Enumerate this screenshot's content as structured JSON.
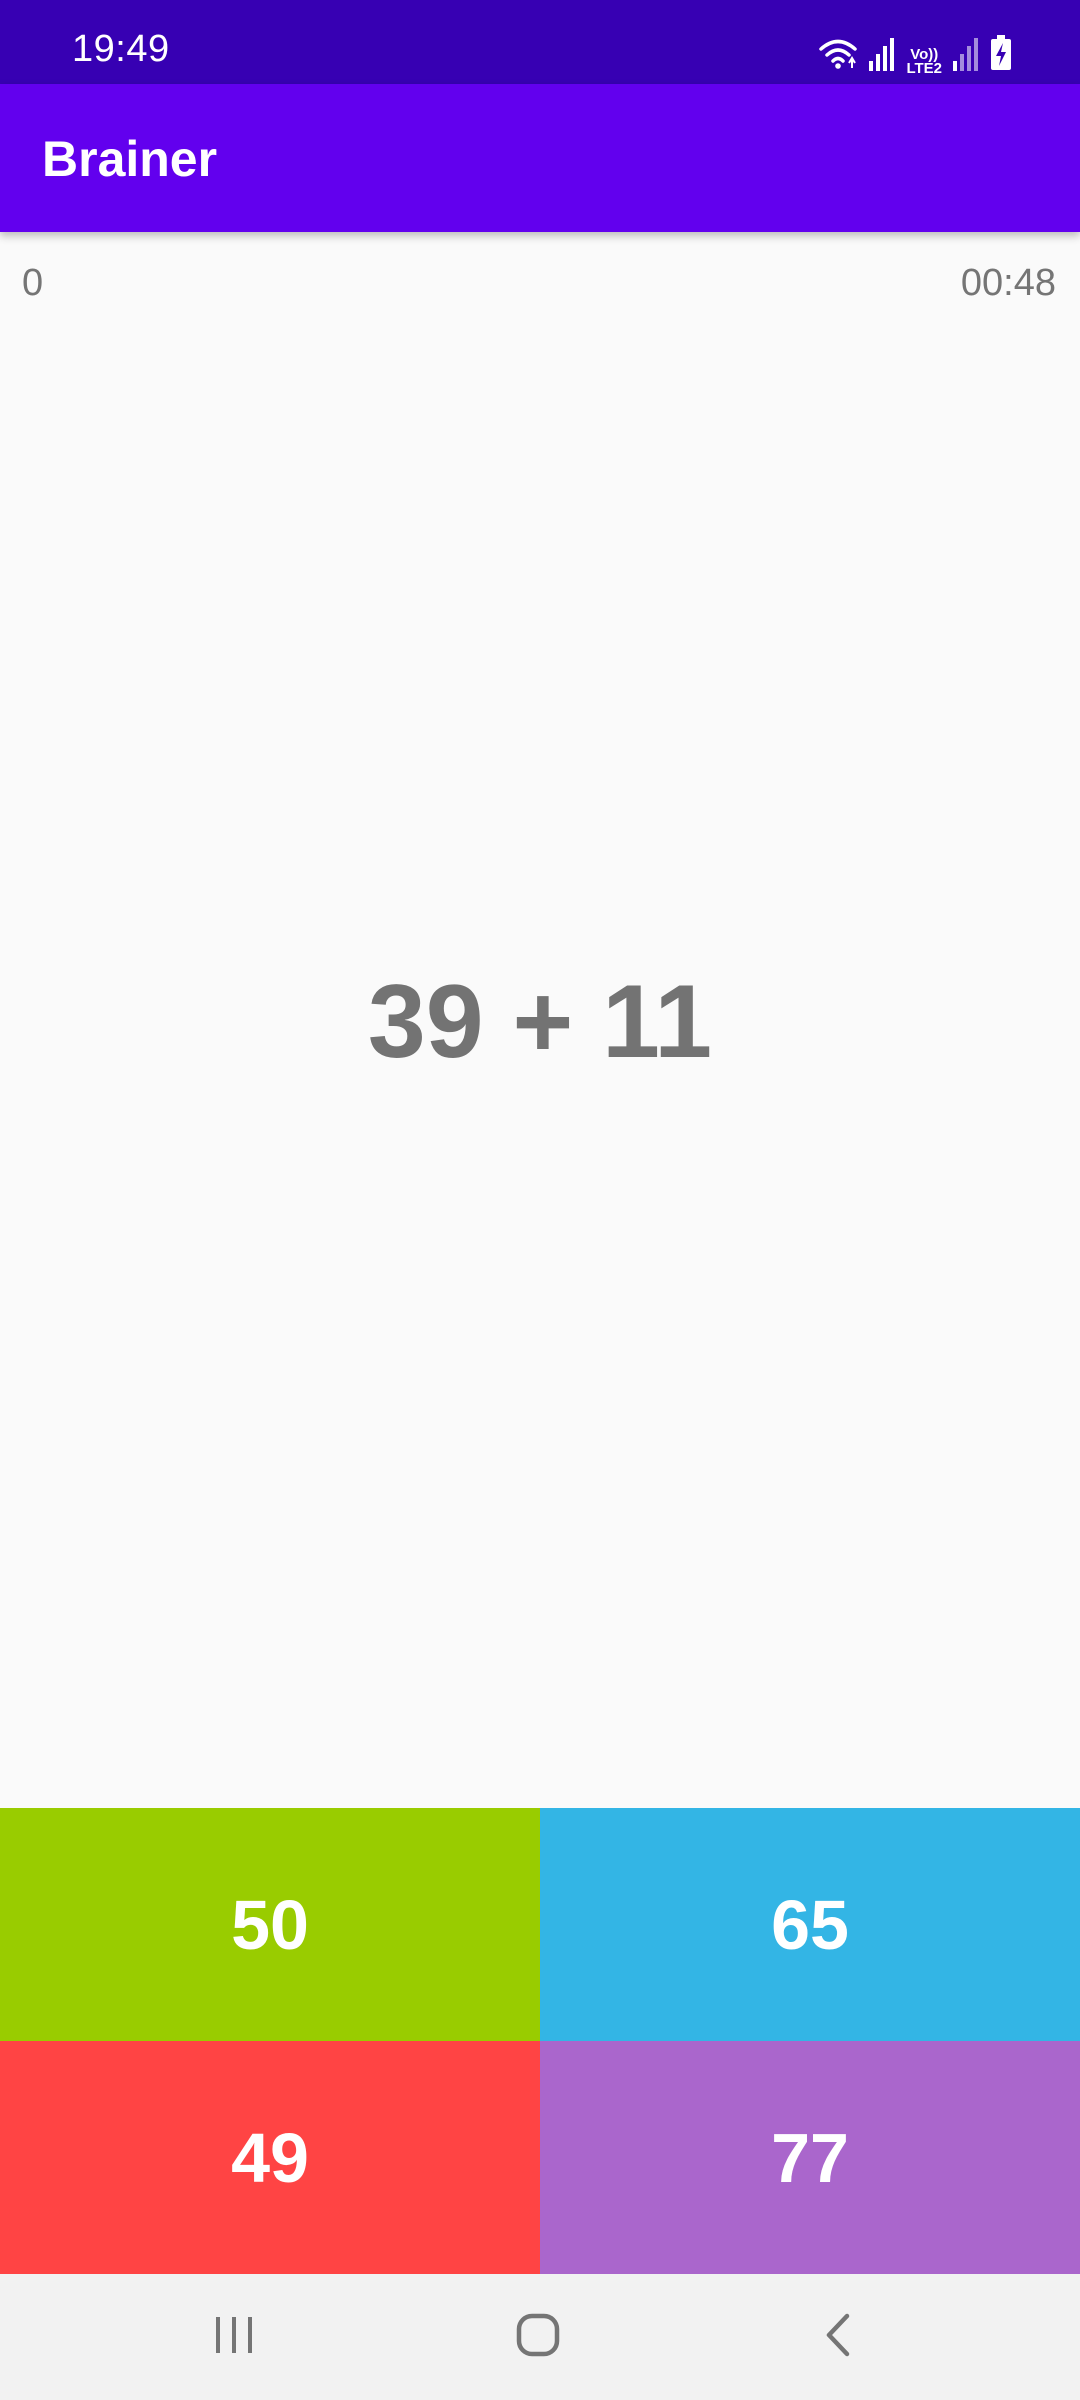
{
  "status_bar": {
    "time": "19:49",
    "lte_top": "Vo))",
    "lte_bottom": "LTE2",
    "icons": [
      "wifi-icon",
      "signal-icon",
      "volte-icon",
      "signal-icon",
      "battery-charging-icon"
    ]
  },
  "app_bar": {
    "title": "Brainer"
  },
  "game": {
    "score": "0",
    "timer": "00:48",
    "question": "39 + 11",
    "answers": [
      {
        "label": "50",
        "color": "#99cc00"
      },
      {
        "label": "65",
        "color": "#33b5e5"
      },
      {
        "label": "49",
        "color": "#ff4444"
      },
      {
        "label": "77",
        "color": "#aa66cc"
      }
    ]
  },
  "nav_bar": {
    "icons": [
      "recents-icon",
      "home-icon",
      "back-icon"
    ]
  },
  "colors": {
    "status_bar": "#3700b3",
    "app_bar": "#6200ee",
    "background": "#fafafa",
    "text_secondary": "#757575"
  }
}
